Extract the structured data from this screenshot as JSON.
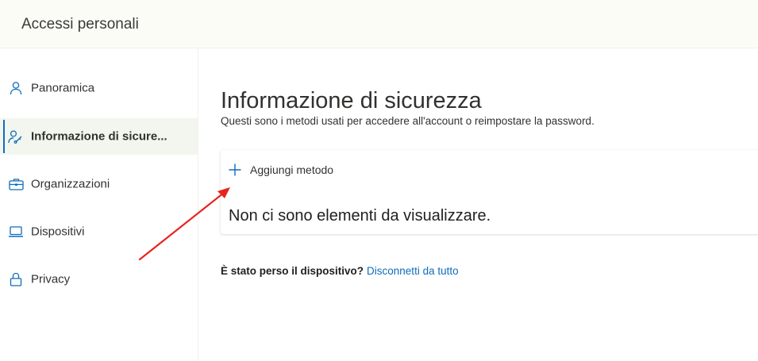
{
  "header": {
    "title": "Accessi personali"
  },
  "sidebar": {
    "items": [
      {
        "label": "Panoramica",
        "icon": "person-icon",
        "active": false
      },
      {
        "label": "Informazione di sicure...",
        "icon": "person-key-icon",
        "active": true
      },
      {
        "label": "Organizzazioni",
        "icon": "briefcase-icon",
        "active": false
      },
      {
        "label": "Dispositivi",
        "icon": "laptop-icon",
        "active": false
      },
      {
        "label": "Privacy",
        "icon": "lock-icon",
        "active": false
      }
    ]
  },
  "main": {
    "title": "Informazione di sicurezza",
    "subtitle": "Questi sono i metodi usati per accedere all'account o reimpostare la password.",
    "add_method_label": "Aggiungi metodo",
    "empty_text": "Non ci sono elementi da visualizzare.",
    "lost_device_question": "È stato perso il dispositivo?",
    "lost_device_link": "Disconnetti da tutto"
  },
  "colors": {
    "accent": "#0f6cbd",
    "annotation_arrow": "#e8231f",
    "header_bg": "#fcfcf6"
  }
}
